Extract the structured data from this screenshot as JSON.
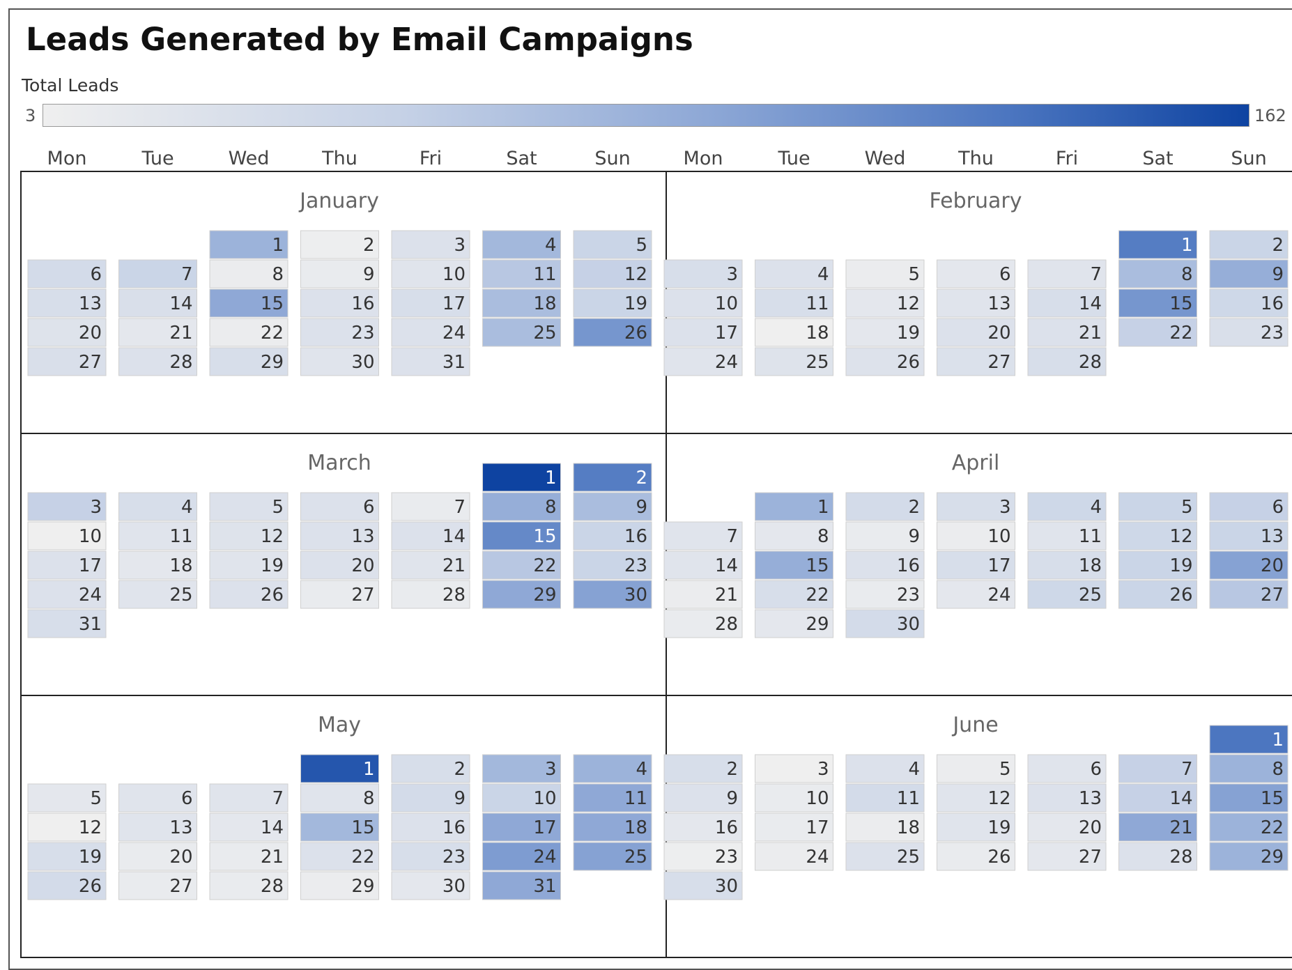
{
  "chart_data": {
    "type": "heatmap",
    "title": "Leads Generated by Email Campaigns",
    "legend": {
      "title": "Total Leads",
      "min": 3,
      "max": 162,
      "placement": "top",
      "color_low": "#efefef",
      "color_high": "#0e43a1"
    },
    "weekdays": [
      "Mon",
      "Tue",
      "Wed",
      "Thu",
      "Fri",
      "Sat",
      "Sun"
    ],
    "months": [
      {
        "name": "January",
        "first_weekday": 2,
        "days": 31,
        "values": [
          80,
          5,
          25,
          75,
          45,
          35,
          45,
          8,
          10,
          20,
          60,
          50,
          30,
          28,
          90,
          25,
          30,
          70,
          45,
          22,
          15,
          8,
          25,
          25,
          70,
          105,
          28,
          25,
          30,
          20,
          25
        ]
      },
      {
        "name": "February",
        "first_weekday": 5,
        "days": 28,
        "values": [
          125,
          45,
          30,
          25,
          8,
          15,
          20,
          70,
          85,
          25,
          30,
          15,
          20,
          30,
          105,
          40,
          25,
          3,
          15,
          25,
          25,
          50,
          28,
          20,
          22,
          24,
          26,
          30
        ]
      },
      {
        "name": "March",
        "first_weekday": 5,
        "days": 31,
        "values": [
          162,
          125,
          50,
          30,
          25,
          25,
          10,
          85,
          70,
          3,
          20,
          22,
          25,
          25,
          115,
          45,
          25,
          15,
          20,
          25,
          20,
          60,
          45,
          25,
          20,
          25,
          10,
          10,
          90,
          95,
          30
        ]
      },
      {
        "name": "April",
        "first_weekday": 1,
        "days": 30,
        "values": [
          80,
          35,
          30,
          40,
          45,
          50,
          20,
          15,
          10,
          8,
          20,
          40,
          45,
          20,
          85,
          25,
          30,
          30,
          45,
          95,
          8,
          30,
          10,
          15,
          40,
          45,
          60,
          10,
          15,
          35
        ]
      },
      {
        "name": "May",
        "first_weekday": 3,
        "days": 31,
        "values": [
          150,
          30,
          75,
          80,
          15,
          20,
          20,
          20,
          35,
          45,
          90,
          3,
          20,
          15,
          75,
          25,
          90,
          90,
          30,
          10,
          10,
          25,
          30,
          100,
          95,
          35,
          10,
          10,
          8,
          15,
          90
        ]
      },
      {
        "name": "June",
        "first_weekday": 6,
        "days": 30,
        "values": [
          130,
          30,
          3,
          25,
          8,
          20,
          50,
          80,
          25,
          10,
          35,
          20,
          25,
          50,
          95,
          15,
          10,
          8,
          20,
          15,
          90,
          80,
          5,
          8,
          25,
          10,
          15,
          25,
          80,
          30
        ]
      }
    ]
  }
}
